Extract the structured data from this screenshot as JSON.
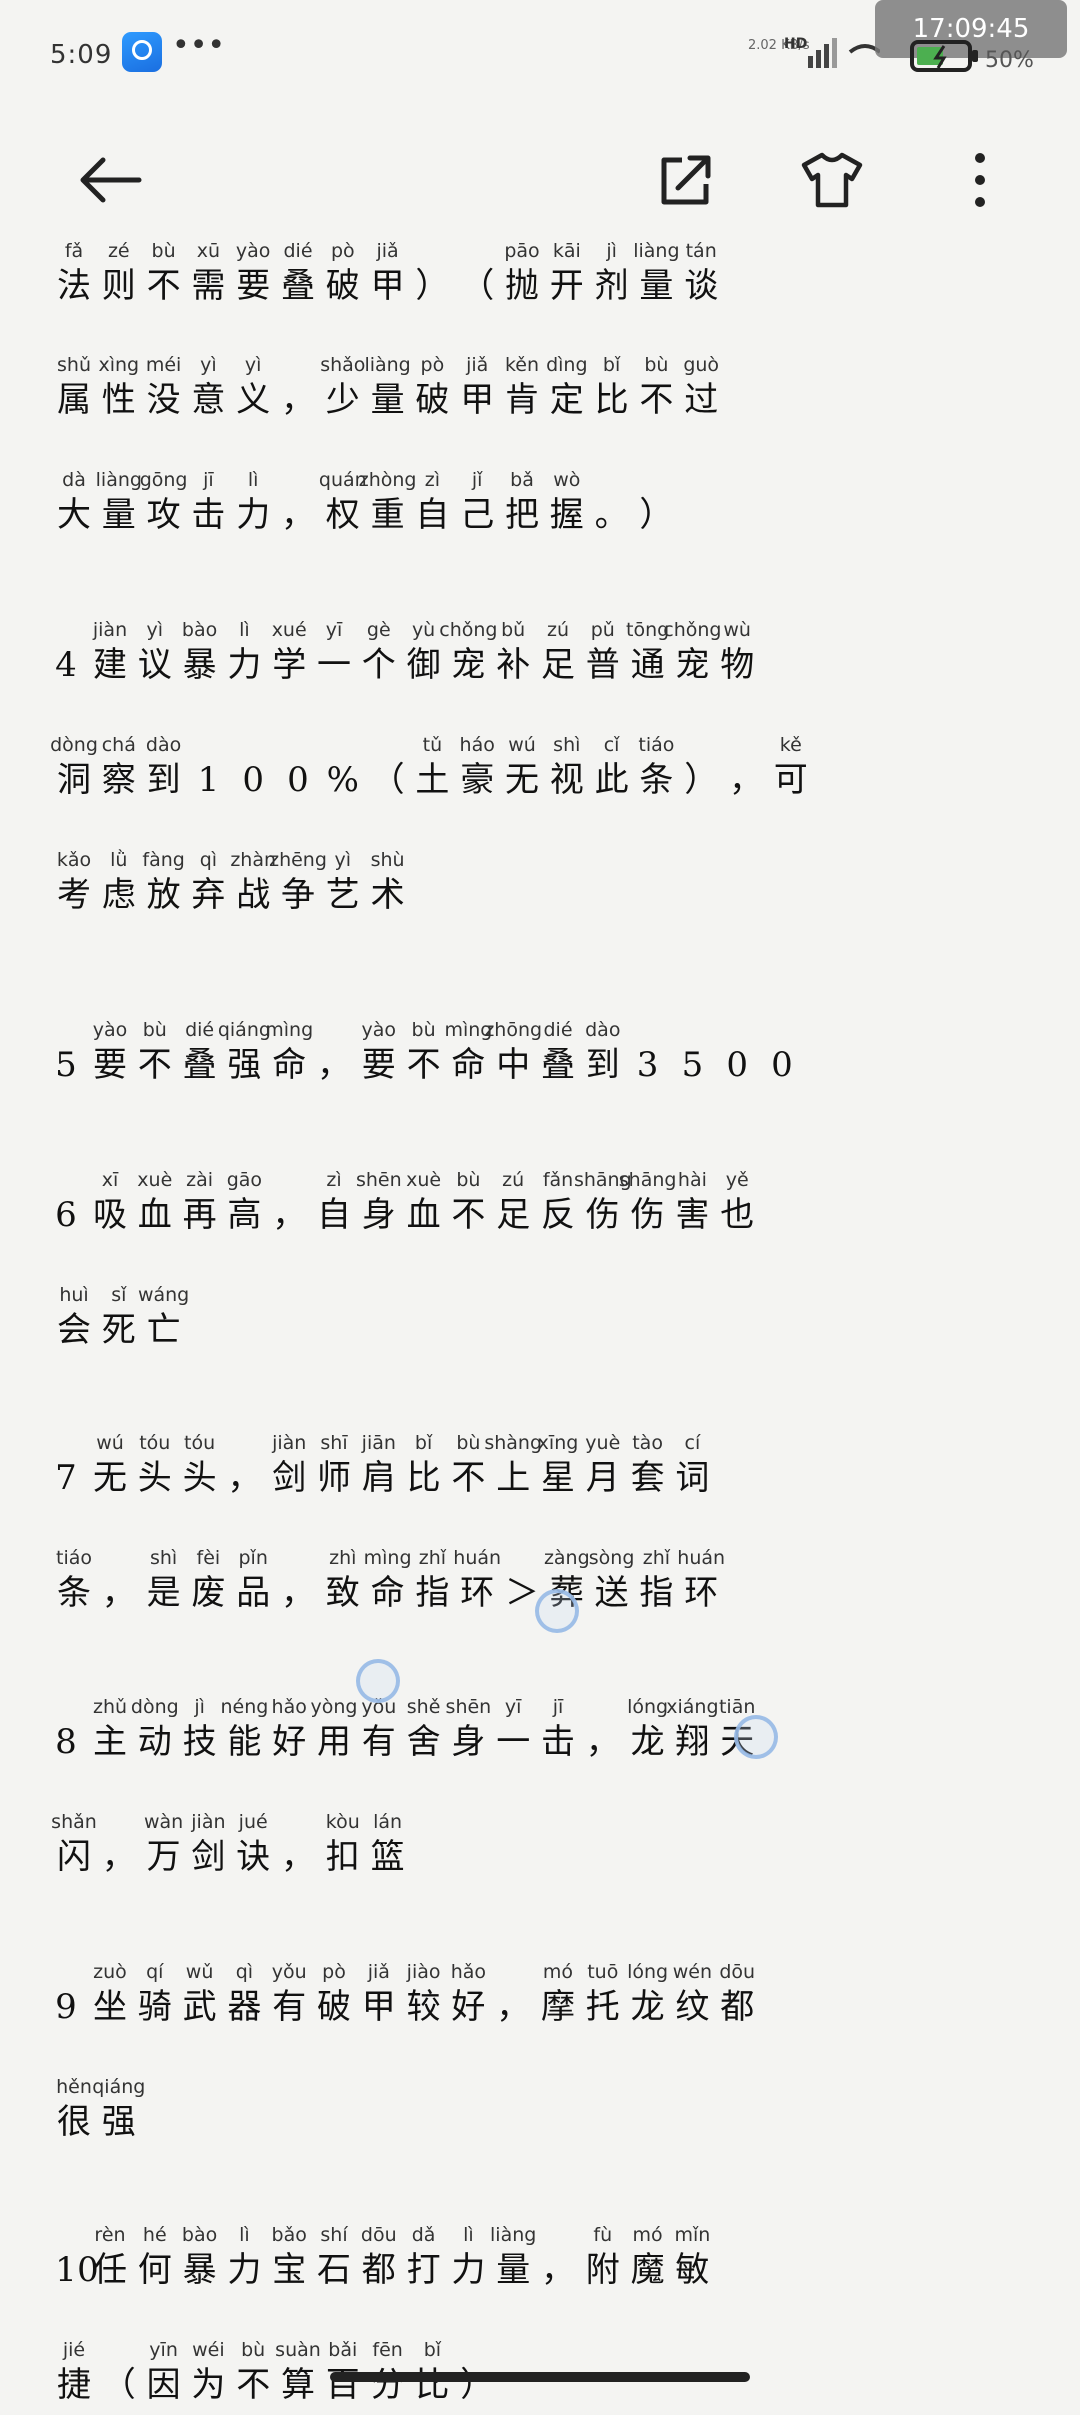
{
  "status_bar": {
    "time": "5:09",
    "net_speed": "2.02 KB/s",
    "network": "HD",
    "overlay_time": "17:09:45",
    "battery": "50%"
  },
  "toolbar": {
    "back_icon": "arrow-left-icon",
    "share_icon": "share-icon",
    "theme_icon": "tshirt-icon",
    "more_icon": "more-vertical-icon"
  },
  "lines": [
    {
      "num": "",
      "cells": [
        [
          "fǎ",
          "法"
        ],
        [
          "zé",
          "则"
        ],
        [
          "bù",
          "不"
        ],
        [
          "xū",
          "需"
        ],
        [
          "yào",
          "要"
        ],
        [
          "dié",
          "叠"
        ],
        [
          "pò",
          "破"
        ],
        [
          "jiǎ",
          "甲"
        ],
        [
          "",
          "）"
        ],
        [
          "",
          "（"
        ],
        [
          "pāo",
          "抛"
        ],
        [
          "kāi",
          "开"
        ],
        [
          "jì",
          "剂"
        ],
        [
          "liàng",
          "量"
        ],
        [
          "tán",
          "谈"
        ]
      ]
    },
    {
      "num": "",
      "cells": [
        [
          "shǔ",
          "属"
        ],
        [
          "xìng",
          "性"
        ],
        [
          "méi",
          "没"
        ],
        [
          "yì",
          "意"
        ],
        [
          "yì",
          "义"
        ],
        [
          "",
          "，"
        ],
        [
          "shǎo",
          "少"
        ],
        [
          "liàng",
          "量"
        ],
        [
          "pò",
          "破"
        ],
        [
          "jiǎ",
          "甲"
        ],
        [
          "kěn",
          "肯"
        ],
        [
          "dìng",
          "定"
        ],
        [
          "bǐ",
          "比"
        ],
        [
          "bù",
          "不"
        ],
        [
          "guò",
          "过"
        ]
      ]
    },
    {
      "num": "",
      "cells": [
        [
          "dà",
          "大"
        ],
        [
          "liàng",
          "量"
        ],
        [
          "gōng",
          "攻"
        ],
        [
          "jī",
          "击"
        ],
        [
          "lì",
          "力"
        ],
        [
          "",
          "，"
        ],
        [
          "quán",
          "权"
        ],
        [
          "zhòng",
          "重"
        ],
        [
          "zì",
          "自"
        ],
        [
          "jǐ",
          "己"
        ],
        [
          "bǎ",
          "把"
        ],
        [
          "wò",
          "握"
        ],
        [
          "",
          "。"
        ],
        [
          "",
          "）"
        ]
      ]
    },
    {
      "num": "4",
      "cells": [
        [
          "",
          "4"
        ],
        [
          "jiàn",
          "建"
        ],
        [
          "yì",
          "议"
        ],
        [
          "bào",
          "暴"
        ],
        [
          "lì",
          "力"
        ],
        [
          "xué",
          "学"
        ],
        [
          "yī",
          "一"
        ],
        [
          "gè",
          "个"
        ],
        [
          "yù",
          "御"
        ],
        [
          "chǒng",
          "宠"
        ],
        [
          "bǔ",
          "补"
        ],
        [
          "zú",
          "足"
        ],
        [
          "pǔ",
          "普"
        ],
        [
          "tōng",
          "通"
        ],
        [
          "chǒng",
          "宠"
        ],
        [
          "wù",
          "物"
        ]
      ]
    },
    {
      "num": "",
      "cells": [
        [
          "dòng",
          "洞"
        ],
        [
          "chá",
          "察"
        ],
        [
          "dào",
          "到"
        ],
        [
          "",
          "1"
        ],
        [
          "",
          "0"
        ],
        [
          "",
          "0"
        ],
        [
          "",
          "%"
        ],
        [
          "",
          "（"
        ],
        [
          "tǔ",
          "土"
        ],
        [
          "háo",
          "豪"
        ],
        [
          "wú",
          "无"
        ],
        [
          "shì",
          "视"
        ],
        [
          "cǐ",
          "此"
        ],
        [
          "tiáo",
          "条"
        ],
        [
          "",
          "）"
        ],
        [
          "",
          "，"
        ],
        [
          "kě",
          "可"
        ]
      ]
    },
    {
      "num": "",
      "cells": [
        [
          "kǎo",
          "考"
        ],
        [
          "lǜ",
          "虑"
        ],
        [
          "fàng",
          "放"
        ],
        [
          "qì",
          "弃"
        ],
        [
          "zhàn",
          "战"
        ],
        [
          "zhēng",
          "争"
        ],
        [
          "yì",
          "艺"
        ],
        [
          "shù",
          "术"
        ]
      ]
    },
    {
      "num": "5",
      "cells": [
        [
          "",
          "5"
        ],
        [
          "yào",
          "要"
        ],
        [
          "bù",
          "不"
        ],
        [
          "dié",
          "叠"
        ],
        [
          "qiáng",
          "强"
        ],
        [
          "mìng",
          "命"
        ],
        [
          "",
          "，"
        ],
        [
          "yào",
          "要"
        ],
        [
          "bù",
          "不"
        ],
        [
          "mìng",
          "命"
        ],
        [
          "zhōng",
          "中"
        ],
        [
          "dié",
          "叠"
        ],
        [
          "dào",
          "到"
        ],
        [
          "",
          "3"
        ],
        [
          "",
          "5"
        ],
        [
          "",
          "0"
        ],
        [
          "",
          "0"
        ]
      ]
    },
    {
      "num": "6",
      "cells": [
        [
          "",
          "6"
        ],
        [
          "xī",
          "吸"
        ],
        [
          "xuè",
          "血"
        ],
        [
          "zài",
          "再"
        ],
        [
          "gāo",
          "高"
        ],
        [
          "",
          "，"
        ],
        [
          "zì",
          "自"
        ],
        [
          "shēn",
          "身"
        ],
        [
          "xuè",
          "血"
        ],
        [
          "bù",
          "不"
        ],
        [
          "zú",
          "足"
        ],
        [
          "fǎn",
          "反"
        ],
        [
          "shāng",
          "伤"
        ],
        [
          "shāng",
          "伤"
        ],
        [
          "hài",
          "害"
        ],
        [
          "yě",
          "也"
        ]
      ]
    },
    {
      "num": "",
      "cells": [
        [
          "huì",
          "会"
        ],
        [
          "sǐ",
          "死"
        ],
        [
          "wáng",
          "亡"
        ]
      ]
    },
    {
      "num": "7",
      "cells": [
        [
          "",
          "7"
        ],
        [
          "wú",
          "无"
        ],
        [
          "tóu",
          "头"
        ],
        [
          "tóu",
          "头"
        ],
        [
          "",
          "，"
        ],
        [
          "jiàn",
          "剑"
        ],
        [
          "shī",
          "师"
        ],
        [
          "jiān",
          "肩"
        ],
        [
          "bǐ",
          "比"
        ],
        [
          "bù",
          "不"
        ],
        [
          "shàng",
          "上"
        ],
        [
          "xīng",
          "星"
        ],
        [
          "yuè",
          "月"
        ],
        [
          "tào",
          "套"
        ],
        [
          "cí",
          "词"
        ]
      ]
    },
    {
      "num": "",
      "cells": [
        [
          "tiáo",
          "条"
        ],
        [
          "",
          "，"
        ],
        [
          "shì",
          "是"
        ],
        [
          "fèi",
          "废"
        ],
        [
          "pǐn",
          "品"
        ],
        [
          "",
          "，"
        ],
        [
          "zhì",
          "致"
        ],
        [
          "mìng",
          "命"
        ],
        [
          "zhǐ",
          "指"
        ],
        [
          "huán",
          "环"
        ],
        [
          "",
          "＞"
        ],
        [
          "zàng",
          "葬"
        ],
        [
          "sòng",
          "送"
        ],
        [
          "zhǐ",
          "指"
        ],
        [
          "huán",
          "环"
        ]
      ]
    },
    {
      "num": "8",
      "cells": [
        [
          "",
          "8"
        ],
        [
          "zhǔ",
          "主"
        ],
        [
          "dòng",
          "动"
        ],
        [
          "jì",
          "技"
        ],
        [
          "néng",
          "能"
        ],
        [
          "hǎo",
          "好"
        ],
        [
          "yòng",
          "用"
        ],
        [
          "yǒu",
          "有"
        ],
        [
          "shě",
          "舍"
        ],
        [
          "shēn",
          "身"
        ],
        [
          "yī",
          "一"
        ],
        [
          "jī",
          "击"
        ],
        [
          "",
          "，"
        ],
        [
          "lóng",
          "龙"
        ],
        [
          "xiáng",
          "翔"
        ],
        [
          "tiān",
          "天"
        ]
      ]
    },
    {
      "num": "",
      "cells": [
        [
          "shǎn",
          "闪"
        ],
        [
          "",
          "，"
        ],
        [
          "wàn",
          "万"
        ],
        [
          "jiàn",
          "剑"
        ],
        [
          "jué",
          "诀"
        ],
        [
          "",
          "，"
        ],
        [
          "kòu",
          "扣"
        ],
        [
          "lán",
          "篮"
        ]
      ]
    },
    {
      "num": "9",
      "cells": [
        [
          "",
          "9"
        ],
        [
          "zuò",
          "坐"
        ],
        [
          "qí",
          "骑"
        ],
        [
          "wǔ",
          "武"
        ],
        [
          "qì",
          "器"
        ],
        [
          "yǒu",
          "有"
        ],
        [
          "pò",
          "破"
        ],
        [
          "jiǎ",
          "甲"
        ],
        [
          "jiào",
          "较"
        ],
        [
          "hǎo",
          "好"
        ],
        [
          "",
          "，"
        ],
        [
          "mó",
          "摩"
        ],
        [
          "tuō",
          "托"
        ],
        [
          "lóng",
          "龙"
        ],
        [
          "wén",
          "纹"
        ],
        [
          "dōu",
          "都"
        ]
      ]
    },
    {
      "num": "",
      "cells": [
        [
          "hěn",
          "很"
        ],
        [
          "qiáng",
          "强"
        ]
      ]
    },
    {
      "num": "10",
      "cells": [
        [
          "",
          "1"
        ],
        [
          "",
          "0"
        ],
        [
          "rèn",
          "任"
        ],
        [
          "hé",
          "何"
        ],
        [
          "bào",
          "暴"
        ],
        [
          "lì",
          "力"
        ],
        [
          "bǎo",
          "宝"
        ],
        [
          "shí",
          "石"
        ],
        [
          "dōu",
          "都"
        ],
        [
          "dǎ",
          "打"
        ],
        [
          "lì",
          "力"
        ],
        [
          "liàng",
          "量"
        ],
        [
          "",
          "，"
        ],
        [
          "fù",
          "附"
        ],
        [
          "mó",
          "魔"
        ],
        [
          "mǐn",
          "敏"
        ]
      ]
    },
    {
      "num": "",
      "cells": [
        [
          "jié",
          "捷"
        ],
        [
          "",
          "（"
        ],
        [
          "yīn",
          "因"
        ],
        [
          "wéi",
          "为"
        ],
        [
          "bù",
          "不"
        ],
        [
          "suàn",
          "算"
        ],
        [
          "bǎi",
          "百"
        ],
        [
          "fēn",
          "分"
        ],
        [
          "bǐ",
          "比"
        ],
        [
          "",
          "）"
        ]
      ]
    }
  ]
}
